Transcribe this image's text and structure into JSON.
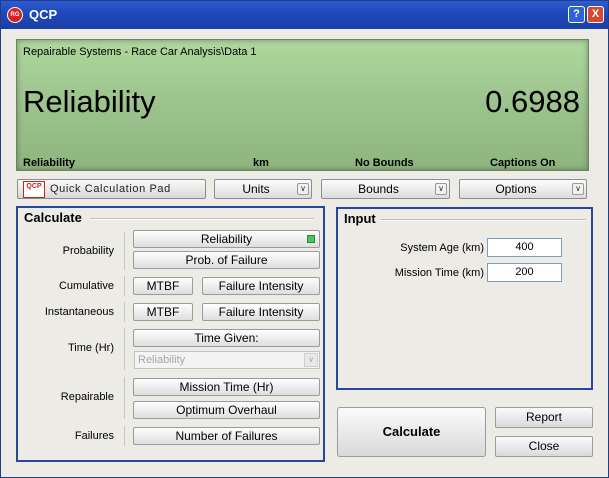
{
  "window": {
    "title": "QCP",
    "app_icon_text": "RG",
    "help_label": "?",
    "close_label": "X"
  },
  "display": {
    "path": "Repairable Systems - Race Car Analysis\\Data 1",
    "metric": "Reliability",
    "value": "0.6988",
    "status": {
      "metric": "Reliability",
      "units": "km",
      "bounds": "No Bounds",
      "captions": "Captions On"
    }
  },
  "toolbar": {
    "qcp_logo_text": "QCP",
    "qcp_label": "Quick Calculation Pad",
    "units_label": "Units",
    "bounds_label": "Bounds",
    "options_label": "Options"
  },
  "calculate": {
    "title": "Calculate",
    "probability_label": "Probability",
    "reliability_btn": "Reliability",
    "prob_failure_btn": "Prob. of Failure",
    "cumulative_label": "Cumulative",
    "cum_mtbf_btn": "MTBF",
    "cum_failure_intensity_btn": "Failure Intensity",
    "instantaneous_label": "Instantaneous",
    "inst_mtbf_btn": "MTBF",
    "inst_failure_intensity_btn": "Failure Intensity",
    "time_label": "Time (Hr)",
    "time_given_btn": "Time Given:",
    "time_given_select": "Reliability",
    "repairable_label": "Repairable",
    "mission_time_btn": "Mission Time (Hr)",
    "optimum_overhaul_btn": "Optimum Overhaul",
    "failures_label": "Failures",
    "number_failures_btn": "Number of Failures"
  },
  "input": {
    "title": "Input",
    "system_age_label": "System Age (km)",
    "system_age_value": "400",
    "mission_time_label": "Mission Time (km)",
    "mission_time_value": "200"
  },
  "actions": {
    "calculate_label": "Calculate",
    "report_label": "Report",
    "close_label": "Close"
  },
  "colors": {
    "title_bar": "#1f48b8",
    "display_bg": "#9cc28d",
    "panel_border": "#29479a",
    "selected_indicator": "#4fc35a"
  }
}
